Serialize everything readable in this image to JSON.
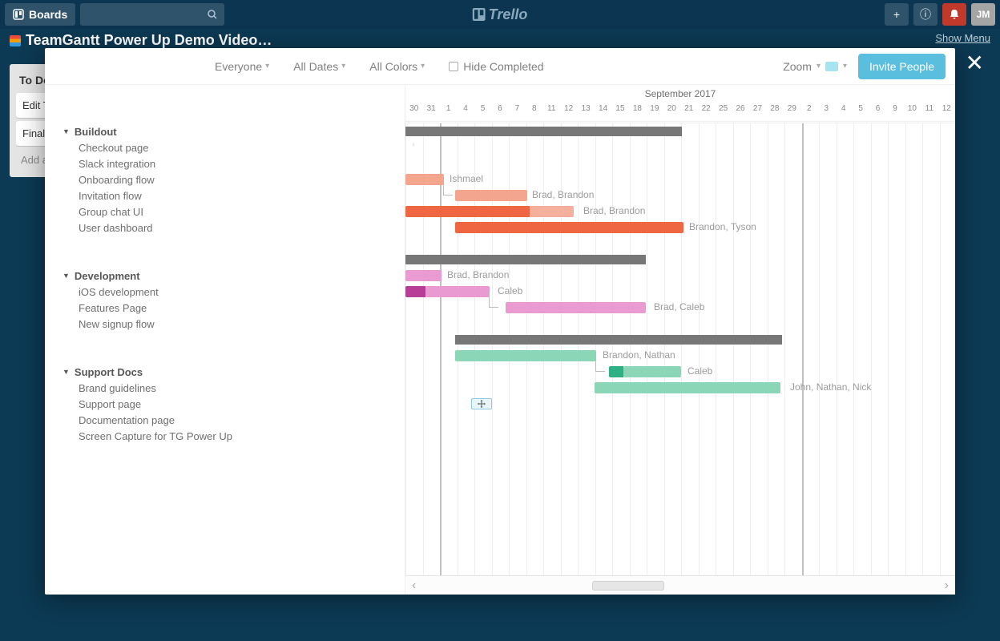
{
  "trello": {
    "boards_label": "Boards",
    "logo": "Trello",
    "show_menu": "Show Menu",
    "user_initials": "JM",
    "board_title": "TeamGantt Power Up Demo Video…",
    "list_title": "To Do",
    "card1": "Edit T…",
    "card2": "Final …",
    "add_card": "Add a…"
  },
  "toolbar": {
    "everyone": "Everyone",
    "all_dates": "All Dates",
    "all_colors": "All Colors",
    "hide_completed": "Hide Completed",
    "zoom": "Zoom",
    "invite": "Invite People"
  },
  "timeline": {
    "month": "September 2017",
    "days": [
      "30",
      "31",
      "1",
      "4",
      "5",
      "6",
      "7",
      "8",
      "11",
      "12",
      "13",
      "14",
      "15",
      "18",
      "19",
      "20",
      "21",
      "22",
      "25",
      "26",
      "27",
      "28",
      "29",
      "2",
      "3",
      "4",
      "5",
      "6",
      "9",
      "10",
      "11",
      "12"
    ]
  },
  "groups": [
    {
      "name": "Buildout",
      "tasks": [
        {
          "name": "Checkout page"
        },
        {
          "name": "Slack integration"
        },
        {
          "name": "Onboarding flow",
          "label": "Ishmael"
        },
        {
          "name": "Invitation flow",
          "label": "Brad, Brandon"
        },
        {
          "name": "Group chat UI",
          "label": "Brad, Brandon"
        },
        {
          "name": "User dashboard",
          "label": "Brandon, Tyson"
        }
      ]
    },
    {
      "name": "Development",
      "tasks": [
        {
          "name": "iOS development",
          "label": "Brad, Brandon"
        },
        {
          "name": "Features Page",
          "label": "Caleb"
        },
        {
          "name": "New signup flow",
          "label": "Brad, Caleb"
        }
      ]
    },
    {
      "name": "Support Docs",
      "tasks": [
        {
          "name": "Brand guidelines",
          "label": "Brandon, Nathan"
        },
        {
          "name": "Support page",
          "label": "Caleb"
        },
        {
          "name": "Documentation page",
          "label": "John, Nathan, Nick"
        },
        {
          "name": "Screen Capture for TG Power Up"
        }
      ]
    }
  ],
  "chart_data": {
    "type": "gantt",
    "timeline_start": "2017-08-30",
    "timeline_end": "2017-10-12",
    "groups": [
      {
        "name": "Buildout",
        "tasks": [
          {
            "name": "Checkout page"
          },
          {
            "name": "Slack integration"
          },
          {
            "name": "Onboarding flow",
            "start": "2017-08-30",
            "end": "2017-09-01",
            "assignees": [
              "Ishmael"
            ],
            "color": "#f4a58e"
          },
          {
            "name": "Invitation flow",
            "start": "2017-09-04",
            "end": "2017-09-08",
            "assignees": [
              "Brad",
              "Brandon"
            ],
            "color": "#f4a58e"
          },
          {
            "name": "Group chat UI",
            "start": "2017-08-30",
            "end": "2017-09-14",
            "assignees": [
              "Brad",
              "Brandon"
            ],
            "progress": 0.55,
            "color": "#ee6642"
          },
          {
            "name": "User dashboard",
            "start": "2017-09-04",
            "end": "2017-09-22",
            "assignees": [
              "Brandon",
              "Tyson"
            ],
            "color": "#ee6642"
          }
        ]
      },
      {
        "name": "Development",
        "tasks": [
          {
            "name": "iOS development",
            "start": "2017-08-30",
            "end": "2017-09-01",
            "assignees": [
              "Brad",
              "Brandon"
            ],
            "color": "#e89ad1"
          },
          {
            "name": "Features Page",
            "start": "2017-08-30",
            "end": "2017-09-06",
            "assignees": [
              "Caleb"
            ],
            "progress": 0.25,
            "color": "#e89ad1"
          },
          {
            "name": "New signup flow",
            "start": "2017-09-08",
            "end": "2017-09-19",
            "assignees": [
              "Brad",
              "Caleb"
            ],
            "color": "#e89ad1"
          }
        ]
      },
      {
        "name": "Support Docs",
        "tasks": [
          {
            "name": "Brand guidelines",
            "start": "2017-09-04",
            "end": "2017-09-14",
            "assignees": [
              "Brandon",
              "Nathan"
            ],
            "color": "#8ad6b7"
          },
          {
            "name": "Support page",
            "start": "2017-09-15",
            "end": "2017-09-22",
            "assignees": [
              "Caleb"
            ],
            "progress": 0.2,
            "color": "#8ad6b7"
          },
          {
            "name": "Documentation page",
            "start": "2017-09-14",
            "end": "2017-09-29",
            "assignees": [
              "John",
              "Nathan",
              "Nick"
            ],
            "color": "#8ad6b7"
          },
          {
            "name": "Screen Capture for TG Power Up",
            "start": "2017-09-05",
            "end": "2017-09-06",
            "color": "#a8e3f0"
          }
        ]
      }
    ]
  }
}
